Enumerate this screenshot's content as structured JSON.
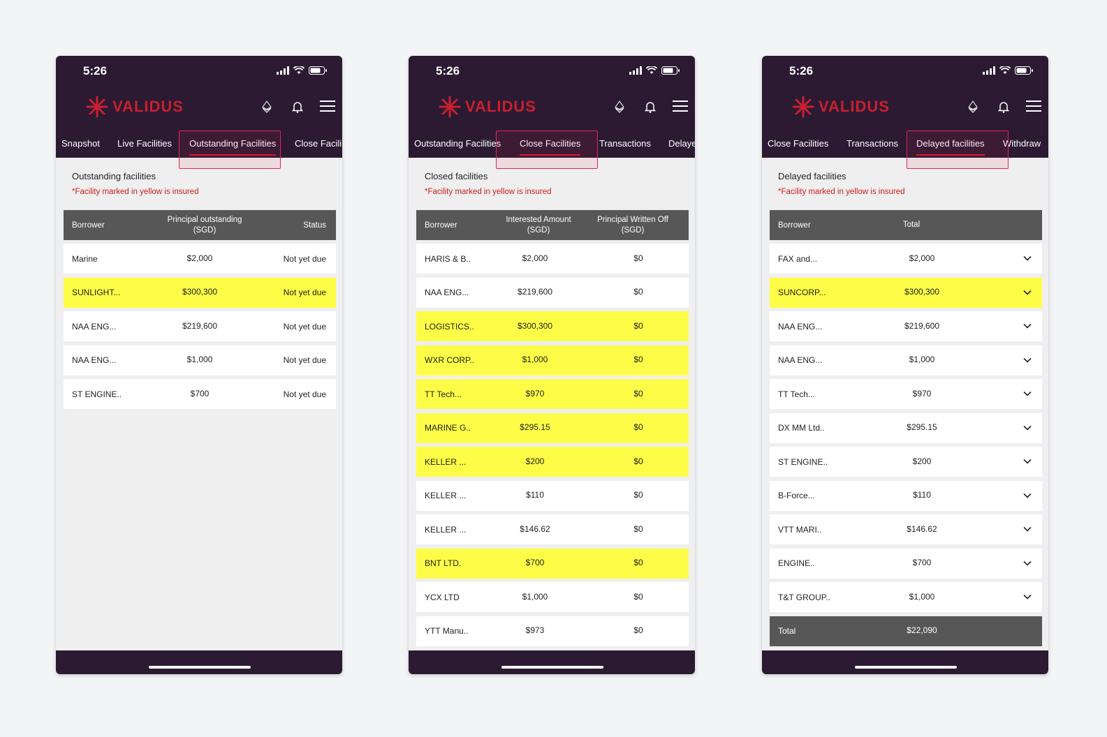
{
  "brand": {
    "name": "VALIDUS",
    "color": "#c8202f"
  },
  "status_time": "5:26",
  "insured_color": "#fdfd47",
  "screens": [
    {
      "tabs": [
        "Snapshot",
        "Live Facilities",
        "Outstanding Facilities",
        "Close Facili"
      ],
      "active_tab": "Outstanding Facilities",
      "title": "Outstanding facilities",
      "note": "*Facility marked in yellow is insured",
      "headers": [
        "Borrower",
        "Principal outstanding\n(SGD)",
        "Status"
      ],
      "rows": [
        {
          "borrower": "Marine",
          "amount": "$2,000",
          "status": "Not yet due",
          "insured": false
        },
        {
          "borrower": "SUNLIGHT...",
          "amount": "$300,300",
          "status": "Not yet due",
          "insured": true
        },
        {
          "borrower": "NAA ENG...",
          "amount": "$219,600",
          "status": "Not yet due",
          "insured": false
        },
        {
          "borrower": "NAA ENG...",
          "amount": "$1,000",
          "status": "Not yet due",
          "insured": false
        },
        {
          "borrower": "ST ENGINE..",
          "amount": "$700",
          "status": "Not yet due",
          "insured": false
        }
      ]
    },
    {
      "tabs": [
        "Outstanding Facilities",
        "Close Facilities",
        "Transactions",
        "Delaye"
      ],
      "active_tab": "Close Facilities",
      "title": "Closed facilities",
      "note": "*Facility marked in yellow is insured",
      "headers": [
        "Borrower",
        "Interested Amount\n(SGD)",
        "Principal Written Off\n(SGD)"
      ],
      "rows": [
        {
          "borrower": "HARIS & B..",
          "amount": "$2,000",
          "written_off": "$0",
          "insured": false
        },
        {
          "borrower": "NAA ENG...",
          "amount": "$219,600",
          "written_off": "$0",
          "insured": false
        },
        {
          "borrower": "LOGISTICS..",
          "amount": "$300,300",
          "written_off": "$0",
          "insured": true
        },
        {
          "borrower": "WXR CORP..",
          "amount": "$1,000",
          "written_off": "$0",
          "insured": true
        },
        {
          "borrower": "TT Tech...",
          "amount": "$970",
          "written_off": "$0",
          "insured": true
        },
        {
          "borrower": "MARINE G..",
          "amount": "$295.15",
          "written_off": "$0",
          "insured": true
        },
        {
          "borrower": "KELLER ...",
          "amount": "$200",
          "written_off": "$0",
          "insured": true
        },
        {
          "borrower": "KELLER ...",
          "amount": "$110",
          "written_off": "$0",
          "insured": false
        },
        {
          "borrower": "KELLER ...",
          "amount": "$146.62",
          "written_off": "$0",
          "insured": false
        },
        {
          "borrower": "BNT LTD.",
          "amount": "$700",
          "written_off": "$0",
          "insured": true
        },
        {
          "borrower": "YCX LTD",
          "amount": "$1,000",
          "written_off": "$0",
          "insured": false
        },
        {
          "borrower": "YTT Manu..",
          "amount": "$973",
          "written_off": "$0",
          "insured": false
        }
      ]
    },
    {
      "tabs": [
        "Close Facilities",
        "Transactions",
        "Delayed facilities",
        "Withdraw"
      ],
      "active_tab": "Delayed facilities",
      "title": "Delayed facilities",
      "note": "*Facility marked in yellow is insured",
      "headers": [
        "Borrower",
        "Total"
      ],
      "rows": [
        {
          "borrower": "FAX and...",
          "amount": "$2,000",
          "insured": false
        },
        {
          "borrower": "SUNCORP...",
          "amount": "$300,300",
          "insured": true
        },
        {
          "borrower": "NAA ENG...",
          "amount": "$219,600",
          "insured": false
        },
        {
          "borrower": "NAA ENG...",
          "amount": "$1,000",
          "insured": false
        },
        {
          "borrower": "TT Tech...",
          "amount": "$970",
          "insured": false
        },
        {
          "borrower": "DX MM Ltd..",
          "amount": "$295.15",
          "insured": false
        },
        {
          "borrower": "ST ENGINE..",
          "amount": "$200",
          "insured": false
        },
        {
          "borrower": "B-Force...",
          "amount": "$110",
          "insured": false
        },
        {
          "borrower": "VTT MARI..",
          "amount": "$146.62",
          "insured": false
        },
        {
          "borrower": "ENGINE..",
          "amount": "$700",
          "insured": false
        },
        {
          "borrower": "T&T GROUP..",
          "amount": "$1,000",
          "insured": false
        }
      ],
      "total": {
        "label": "Total",
        "amount": "$22,090"
      }
    }
  ]
}
